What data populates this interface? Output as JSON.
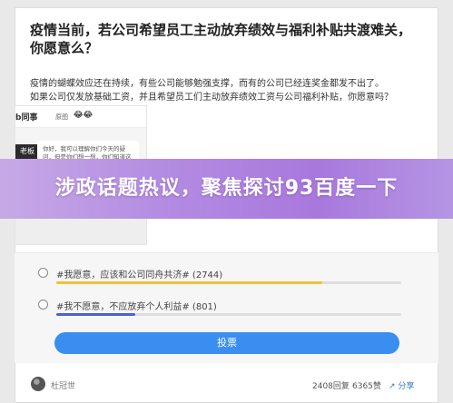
{
  "post": {
    "title": "疫情当前，若公司希望员工主动放弃绩效与福利补贴共渡难关，你愿意么？",
    "body_line1": "疫情的蝴蝶效应还在持续，有些公司能够勉强支撑，而有的公司已经连奖金都发不出了。",
    "body_line2": "如果公司仅发放基础工资，并且希望员工们主动放弃绩效工资与公司福利补贴，你愿意吗？"
  },
  "screenshot": {
    "logo": "b同事",
    "user": "原图",
    "emoji": "😂😂",
    "boss_tag": "老板",
    "bubble_text": "你好，我可以理解你们今天的疑问，但是你们想一想，你们知道这次疫情公司损失多少吗？你们知道疫情结束之后有多少人愿意来公司吗？我很担心，希望大家能一起承担，放弃绩效，有困难可以来找我……"
  },
  "banner": {
    "text": "涉政话题热议，聚焦探讨93百度一下"
  },
  "poll": {
    "options": [
      {
        "label": "#我愿意，应该和公司同舟共济# (2744)",
        "fraction": 0.77,
        "color": "#f1c232"
      },
      {
        "label": "#我不愿意，不应放弃个人利益# (801)",
        "fraction": 0.23,
        "color": "#4b5fe0"
      }
    ],
    "vote_label": "投票"
  },
  "footer": {
    "author": "杜冠世",
    "reads": "2408回复",
    "likes": "6365赞",
    "share": "分享"
  }
}
